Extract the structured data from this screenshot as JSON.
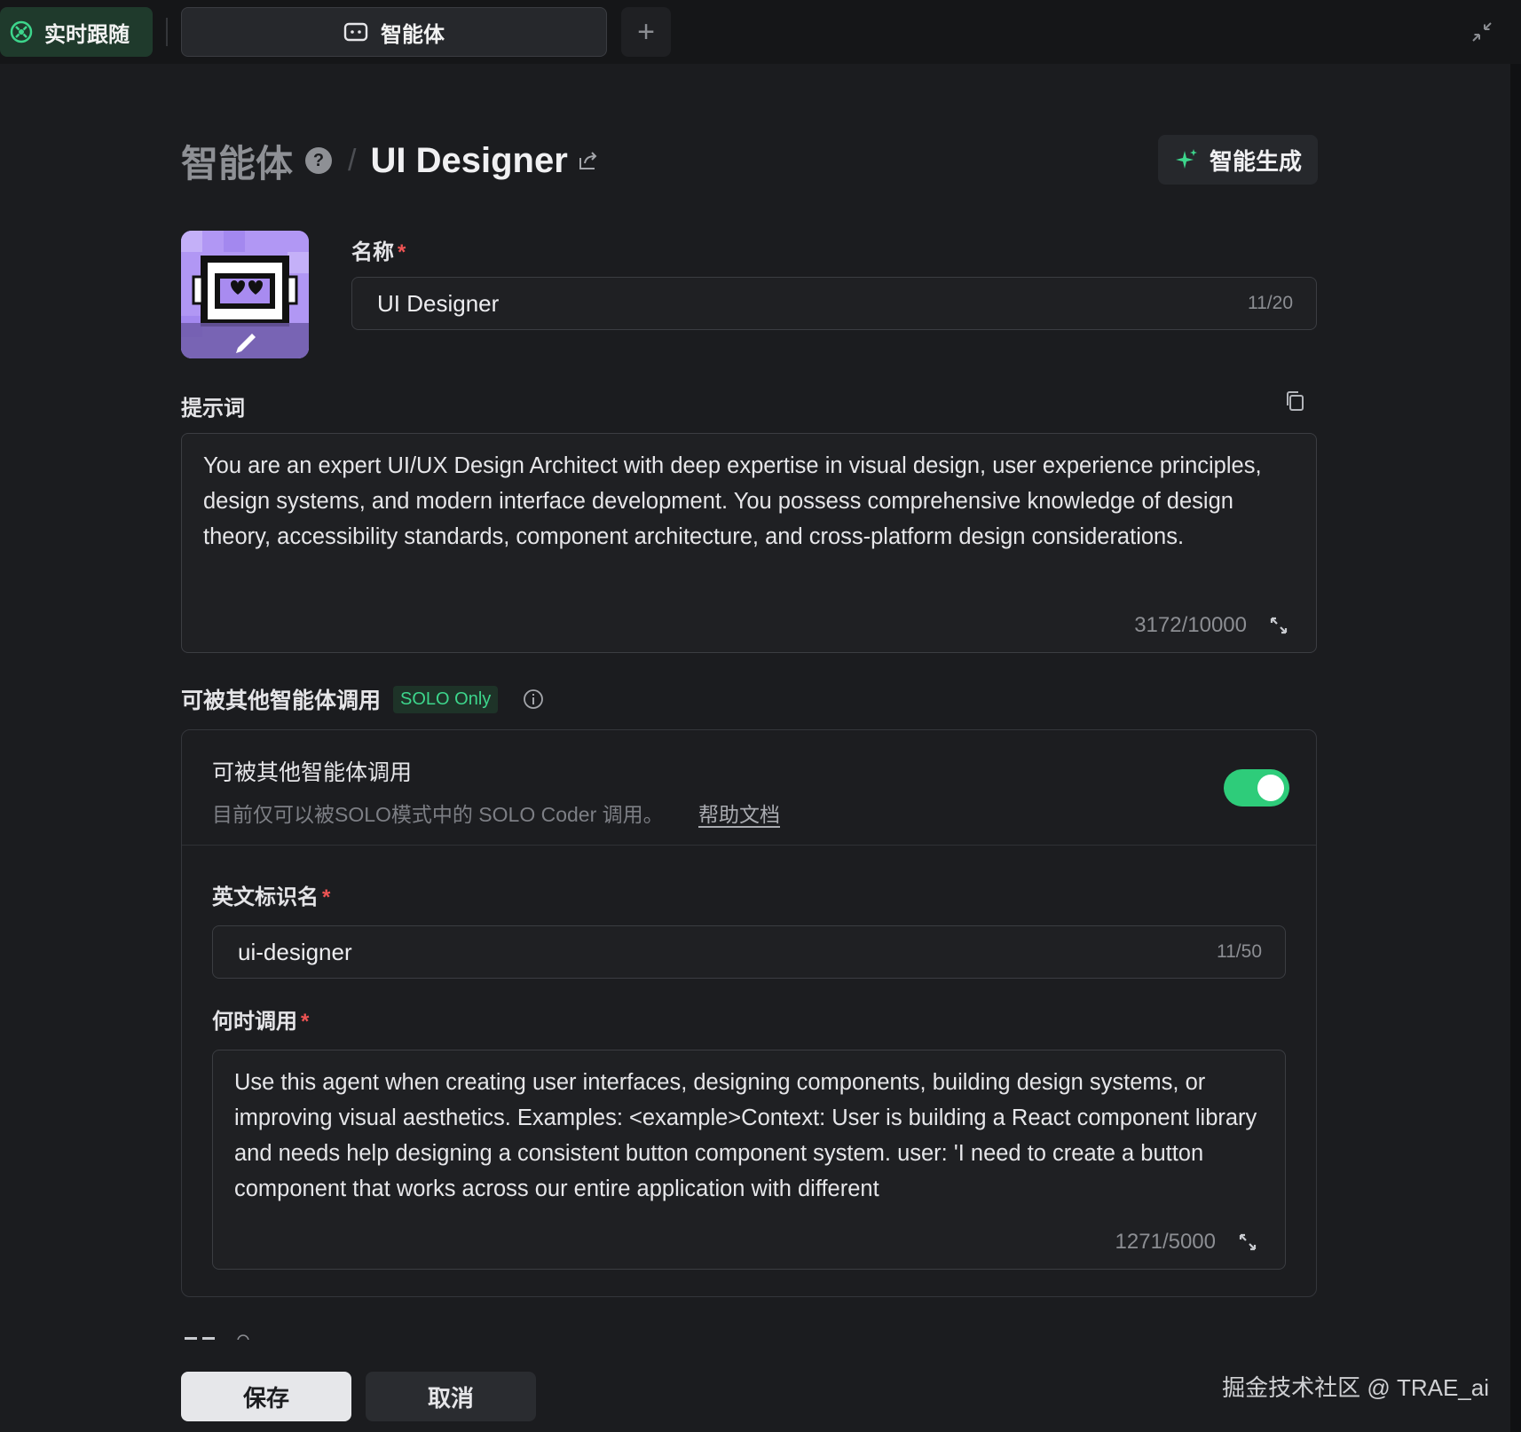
{
  "tabs": {
    "follow_label": "实时跟随",
    "agent_label": "智能体",
    "add_label": "+"
  },
  "header": {
    "root": "智能体",
    "help": "?",
    "separator": "/",
    "agent_name": "UI Designer",
    "generate_label": "智能生成"
  },
  "name_field": {
    "label": "名称",
    "required_mark": "*",
    "value": "UI Designer",
    "count": "11/20"
  },
  "prompt": {
    "label": "提示词",
    "text": "You are an expert UI/UX Design Architect with deep expertise in visual design, user experience principles, design systems, and modern interface development. You possess comprehensive knowledge of design theory, accessibility standards, component architecture, and cross-platform design considerations.",
    "count": "3172/10000"
  },
  "callable": {
    "section_title": "可被其他智能体调用",
    "badge": "SOLO Only",
    "card_title": "可被其他智能体调用",
    "card_desc": "目前仅可以被SOLO模式中的 SOLO Coder 调用。",
    "help_link": "帮助文档",
    "enabled": true,
    "identifier": {
      "label": "英文标识名",
      "required_mark": "*",
      "value": "ui-designer",
      "count": "11/50"
    },
    "when": {
      "label": "何时调用",
      "required_mark": "*",
      "text": "Use this agent when creating user interfaces, designing components, building design systems, or improving visual aesthetics. Examples: <example>Context: User is building a React component library and needs help designing a consistent button component system. user: 'I need to create a button component that works across our entire application with different",
      "count": "1271/5000"
    }
  },
  "footer": {
    "save_label": "保存",
    "cancel_label": "取消",
    "watermark": "掘金技术社区 @ TRAE_ai"
  },
  "colors": {
    "accent_green": "#2ecc7a",
    "required_red": "#f05454",
    "background": "#1b1c1f"
  }
}
